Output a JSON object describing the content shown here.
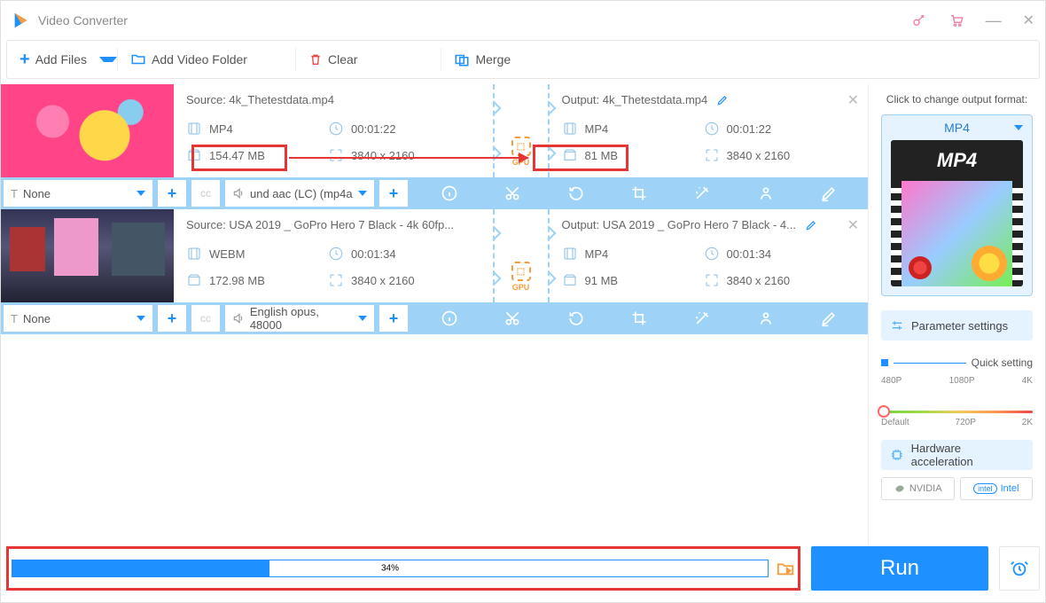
{
  "app": {
    "title": "Video Converter"
  },
  "toolbar": {
    "add_files": "Add Files",
    "add_folder": "Add Video Folder",
    "clear": "Clear",
    "merge": "Merge"
  },
  "files": [
    {
      "source_label": "Source: 4k_Thetestdata.mp4",
      "output_label": "Output: 4k_Thetestdata.mp4",
      "src": {
        "format": "MP4",
        "duration": "00:01:22",
        "size": "154.47 MB",
        "res": "3840 x 2160"
      },
      "out": {
        "format": "MP4",
        "duration": "00:01:22",
        "size": "81 MB",
        "res": "3840 x 2160"
      },
      "subtitle": "None",
      "audio": "und aac (LC) (mp4a"
    },
    {
      "source_label": "Source: USA 2019 _ GoPro Hero 7 Black - 4k 60fp...",
      "output_label": "Output: USA 2019 _ GoPro Hero 7 Black - 4...",
      "src": {
        "format": "WEBM",
        "duration": "00:01:34",
        "size": "172.98 MB",
        "res": "3840 x 2160"
      },
      "out": {
        "format": "MP4",
        "duration": "00:01:34",
        "size": "91 MB",
        "res": "3840 x 2160"
      },
      "subtitle": "None",
      "audio": "English opus, 48000"
    }
  ],
  "gpu_label": "GPU",
  "sidebar": {
    "hint": "Click to change output format:",
    "format": "MP4",
    "param_btn": "Parameter settings",
    "quick": "Quick setting",
    "quality_top": [
      "480P",
      "1080P",
      "4K"
    ],
    "quality_bot": [
      "Default",
      "720P",
      "2K"
    ],
    "hw": "Hardware acceleration",
    "nvidia": "NVIDIA",
    "intel": "Intel"
  },
  "footer": {
    "progress": "34%",
    "run": "Run"
  }
}
